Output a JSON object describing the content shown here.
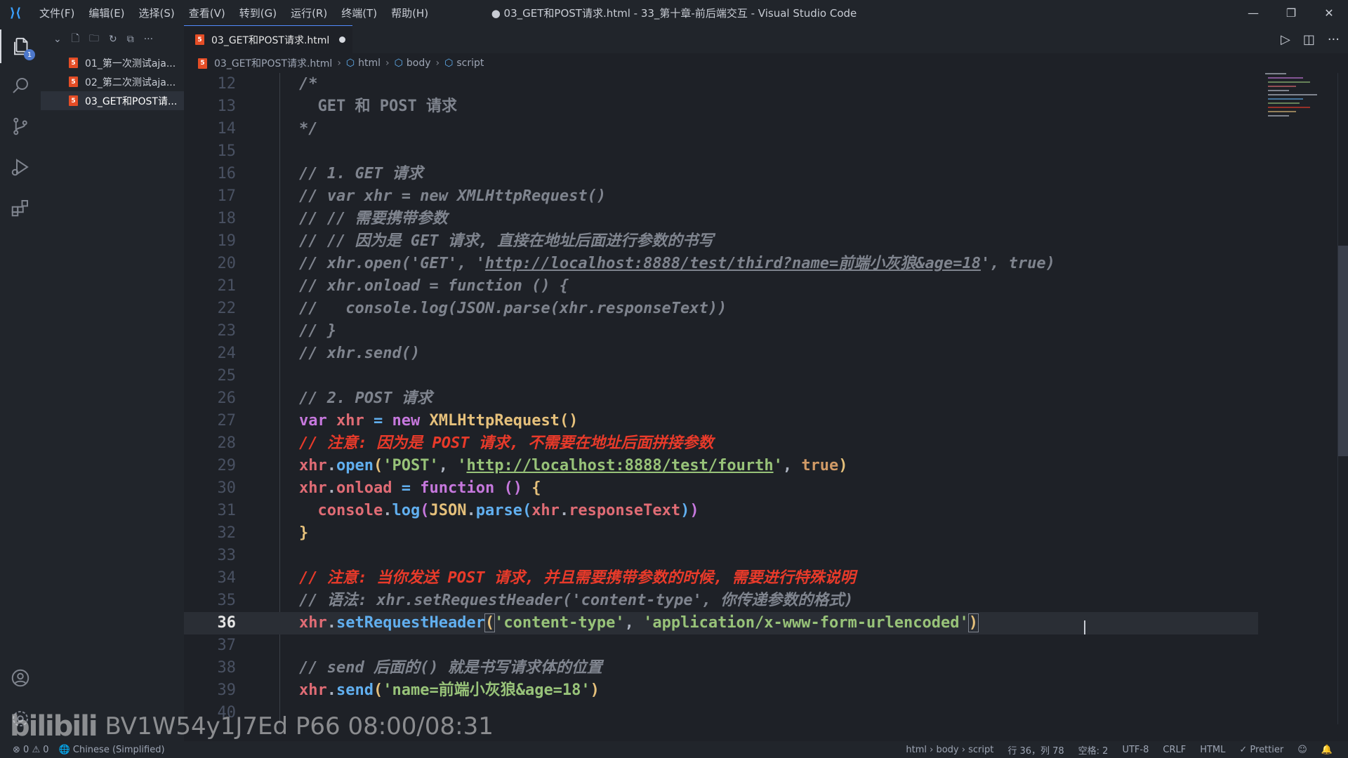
{
  "window": {
    "title": "● 03_GET和POST请求.html - 33_第十章-前后端交互 - Visual Studio Code",
    "controls": [
      "—",
      "❐",
      "✕"
    ]
  },
  "menu": [
    "文件(F)",
    "编辑(E)",
    "选择(S)",
    "查看(V)",
    "转到(G)",
    "运行(R)",
    "终端(T)",
    "帮助(H)"
  ],
  "activity": {
    "explorer_badge": "1"
  },
  "explorer": {
    "files": [
      "01_第一次测试aja...",
      "02_第二次测试aja...",
      "03_GET和POST请..."
    ]
  },
  "tab": {
    "label": "03_GET和POST请求.html"
  },
  "breadcrumb": {
    "file": "03_GET和POST请求.html",
    "items": [
      "html",
      "body",
      "script"
    ]
  },
  "editor": {
    "current_line": "36",
    "line_numbers": [
      "12",
      "13",
      "14",
      "15",
      "16",
      "17",
      "18",
      "19",
      "20",
      "21",
      "22",
      "23",
      "24",
      "25",
      "26",
      "27",
      "28",
      "29",
      "30",
      "31",
      "32",
      "33",
      "34",
      "35",
      "36",
      "37",
      "38",
      "39",
      "40"
    ]
  },
  "status": {
    "errors": "0",
    "warnings": "0",
    "language_pack": "Chinese (Simplified)",
    "path": "html › body › script",
    "position": "行 36，列 78",
    "spaces": "空格: 2",
    "encoding": "UTF-8",
    "eol": "CRLF",
    "language": "HTML",
    "formatter": "✓ Prettier"
  },
  "watermark": {
    "logo": "bilibili",
    "text": "BV1W54y1J7Ed P66 08:00/08:31"
  },
  "colors": {
    "background": "#1e2127",
    "comment": "#7f848e",
    "comment_highlight": "#e83a2a",
    "keyword": "#c678dd",
    "variable": "#e06c75",
    "function": "#61afef",
    "string": "#98c379",
    "class": "#e5c07b"
  }
}
